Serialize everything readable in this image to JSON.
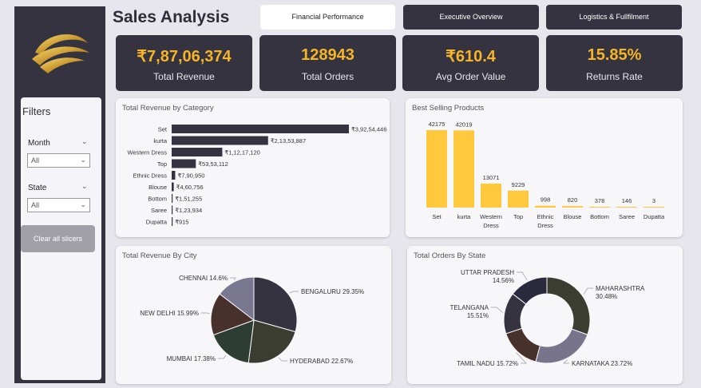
{
  "header": {
    "title": "Sales Analysis",
    "tabs": [
      {
        "label": "Financial Performance",
        "active": true
      },
      {
        "label": "Executive Overview",
        "active": false
      },
      {
        "label": "Logistics & Fullfilment",
        "active": false
      }
    ]
  },
  "kpis": [
    {
      "value": "₹7,87,06,374",
      "label": "Total Revenue"
    },
    {
      "value": "128943",
      "label": "Total Orders"
    },
    {
      "value": "₹610.4",
      "label": "Avg Order Value"
    },
    {
      "value": "15.85%",
      "label": "Returns Rate"
    }
  ],
  "filters": {
    "title": "Filters",
    "month": {
      "label": "Month",
      "value": "All"
    },
    "state": {
      "label": "State",
      "value": "All"
    },
    "clear_label": "Clear all slicers"
  },
  "colors": {
    "accent": "#f5b526",
    "dark_panel": "#353340",
    "bar_yellow": "#ffc83d"
  },
  "chart_data": [
    {
      "type": "bar",
      "orientation": "horizontal",
      "title": "Total Revenue by Category",
      "categories": [
        "Set",
        "kurta",
        "Western Dress",
        "Top",
        "Ethnic Dress",
        "Blouse",
        "Bottom",
        "Saree",
        "Dupatta"
      ],
      "values": [
        39254446,
        21353887,
        11217120,
        5353112,
        790950,
        460756,
        151255,
        123934,
        915
      ],
      "labels": [
        "₹3,92,54,446",
        "₹2,13,53,887",
        "₹1,12,17,120",
        "₹53,53,112",
        "₹7,90,950",
        "₹4,60,756",
        "₹1,51,255",
        "₹1,23,934",
        "₹915"
      ],
      "color": "#353340"
    },
    {
      "type": "bar",
      "title": "Best Selling Products",
      "categories": [
        "Set",
        "kurta",
        "Western Dress",
        "Top",
        "Ethnic Dress",
        "Blouse",
        "Bottom",
        "Saree",
        "Dupatta"
      ],
      "values": [
        42175,
        42019,
        13071,
        9229,
        998,
        820,
        378,
        146,
        3
      ],
      "color": "#ffc83d"
    },
    {
      "type": "pie",
      "title": "Total Revenue By City",
      "slices": [
        {
          "label": "BENGALURU",
          "pct": 29.35,
          "display": "BENGALURU 29.35%",
          "color": "#353340"
        },
        {
          "label": "HYDERABAD",
          "pct": 22.67,
          "display": "HYDERABAD 22.67%",
          "color": "#3b3d30"
        },
        {
          "label": "MUMBAI",
          "pct": 17.38,
          "display": "MUMBAI 17.38%",
          "color": "#2e3d34"
        },
        {
          "label": "NEW DELHI",
          "pct": 15.99,
          "display": "NEW DELHI 15.99%",
          "color": "#48302d"
        },
        {
          "label": "CHENNAI",
          "pct": 14.6,
          "display": "CHENNAI 14.6%",
          "color": "#7a7790"
        }
      ]
    },
    {
      "type": "pie",
      "donut": true,
      "title": "Total Orders By State",
      "slices": [
        {
          "label": "MAHARASHTRA",
          "pct": 30.48,
          "display1": "MAHARASHTRA",
          "display2": "30.48%",
          "color": "#3b3d30"
        },
        {
          "label": "KARNATAKA",
          "pct": 23.72,
          "display1": "KARNATAKA 23.72%",
          "display2": "",
          "color": "#77748c"
        },
        {
          "label": "TAMIL NADU",
          "pct": 15.72,
          "display1": "TAMIL NADU 15.72%",
          "display2": "",
          "color": "#48302d"
        },
        {
          "label": "TELANGANA",
          "pct": 15.51,
          "display1": "TELANGANA",
          "display2": "15.51%",
          "color": "#353340"
        },
        {
          "label": "UTTAR PRADESH",
          "pct": 14.56,
          "display1": "UTTAR PRADESH",
          "display2": "14.56%",
          "color": "#2b2a3d"
        }
      ]
    }
  ]
}
